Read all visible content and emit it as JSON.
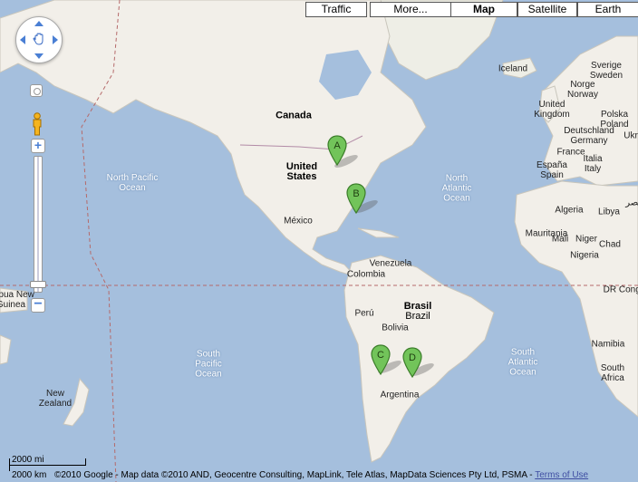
{
  "top_controls": {
    "traffic": "Traffic",
    "more": "More...",
    "map": "Map",
    "satellite": "Satellite",
    "earth": "Earth"
  },
  "labels": {
    "canada": "Canada",
    "us1": "United",
    "us2": "States",
    "mexico": "México",
    "iceland": "Iceland",
    "sverige": "Sverige",
    "sweden": "Sweden",
    "norge": "Norge",
    "norway": "Norway",
    "uk1": "United",
    "uk2": "Kingdom",
    "polska": "Polska",
    "poland": "Poland",
    "deutschland": "Deutschland",
    "germany": "Germany",
    "france": "France",
    "ukr": "Ukr",
    "espana": "España",
    "spain": "Spain",
    "italia": "Italia",
    "italy": "Italy",
    "algeria": "Algeria",
    "libya": "Libya",
    "mauritania": "Mauritania",
    "mali": "Mali",
    "niger": "Niger",
    "chad": "Chad",
    "nigeria": "Nigeria",
    "drcongo": "DR Congo",
    "namibia": "Namibia",
    "south_africa1": "South",
    "south_africa2": "Africa",
    "venezuela": "Venezuela",
    "colombia": "Colombia",
    "peru": "Perú",
    "bolivia": "Bolivia",
    "brasil": "Brasil",
    "brazil": "Brazil",
    "argentina": "Argentina",
    "npo1": "North Pacific",
    "npo2": "Ocean",
    "nao1": "North",
    "nao2": "Atlantic",
    "nao3": "Ocean",
    "spo1": "South",
    "spo2": "Pacific",
    "spo3": "Ocean",
    "sao1": "South",
    "sao2": "Atlantic",
    "sao3": "Ocean",
    "nz1": "New",
    "nz2": "Zealand",
    "png1": "Papua New",
    "png2": "Guinea",
    "arabic": "مصر",
    "egypt": "Egypt"
  },
  "markers": [
    "A",
    "B",
    "C",
    "D"
  ],
  "scale": {
    "mi": "2000 mi",
    "km": "2000 km"
  },
  "footer": {
    "copyright": "©2010 Google - Map data ©2010 AND, Geocentre Consulting, MapLink, Tele Atlas, MapData Sciences Pty Ltd, PSMA - ",
    "terms": "Terms of Use"
  }
}
